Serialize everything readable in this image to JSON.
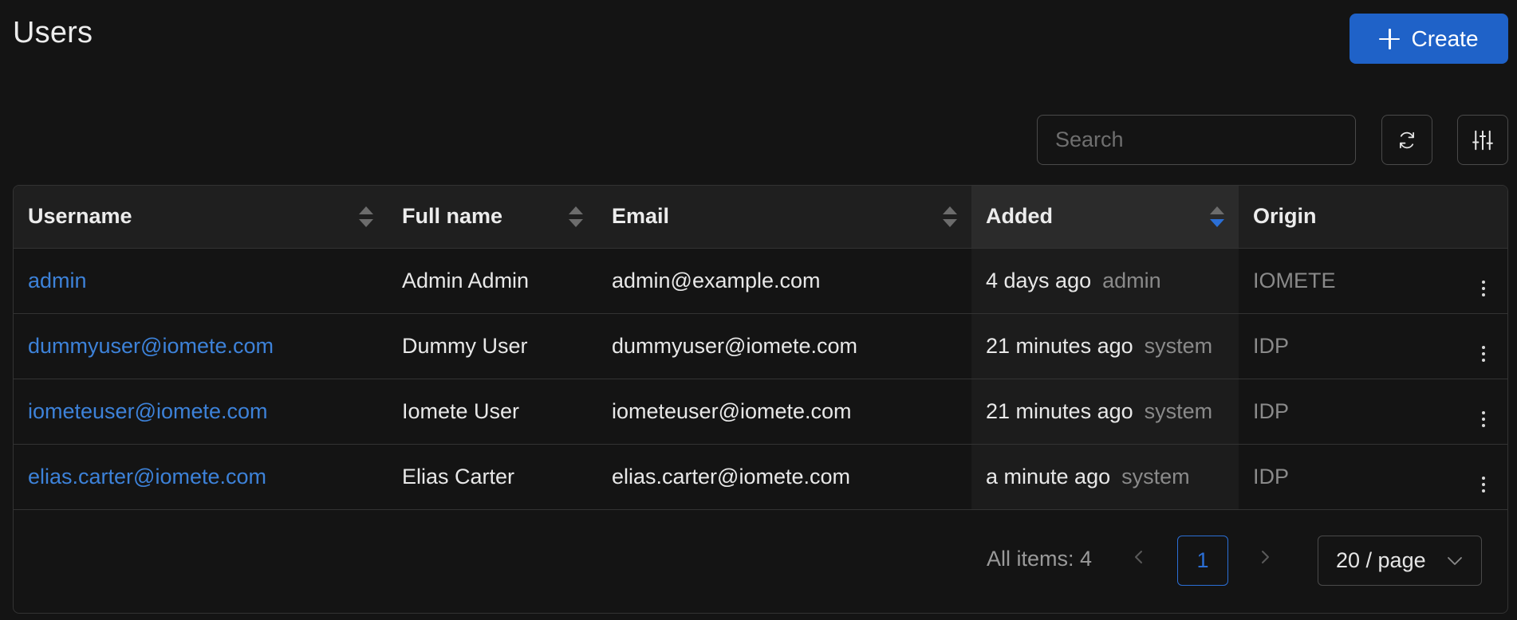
{
  "header": {
    "title": "Users",
    "create_label": "Create"
  },
  "toolbar": {
    "search_placeholder": "Search"
  },
  "table": {
    "columns": {
      "username": "Username",
      "full_name": "Full name",
      "email": "Email",
      "added": "Added",
      "origin": "Origin"
    },
    "rows": [
      {
        "username": "admin",
        "full_name": "Admin Admin",
        "email": "admin@example.com",
        "added": "4 days ago",
        "added_by": "admin",
        "origin": "IOMETE"
      },
      {
        "username": "dummyuser@iomete.com",
        "full_name": "Dummy User",
        "email": "dummyuser@iomete.com",
        "added": "21 minutes ago",
        "added_by": "system",
        "origin": "IDP"
      },
      {
        "username": "iometeuser@iomete.com",
        "full_name": "Iomete User",
        "email": "iometeuser@iomete.com",
        "added": "21 minutes ago",
        "added_by": "system",
        "origin": "IDP"
      },
      {
        "username": "elias.carter@iomete.com",
        "full_name": "Elias Carter",
        "email": "elias.carter@iomete.com",
        "added": "a minute ago",
        "added_by": "system",
        "origin": "IDP"
      }
    ]
  },
  "pagination": {
    "all_items": "All items: 4",
    "current_page": "1",
    "page_size": "20 / page"
  },
  "colors": {
    "accent": "#1f62c8",
    "link": "#3d82d9",
    "background": "#141414"
  },
  "icons": [
    "plus-icon",
    "refresh-icon",
    "sliders-icon",
    "sort-icon",
    "kebab-icon",
    "chevron-left-icon",
    "chevron-right-icon",
    "chevron-down-icon"
  ]
}
